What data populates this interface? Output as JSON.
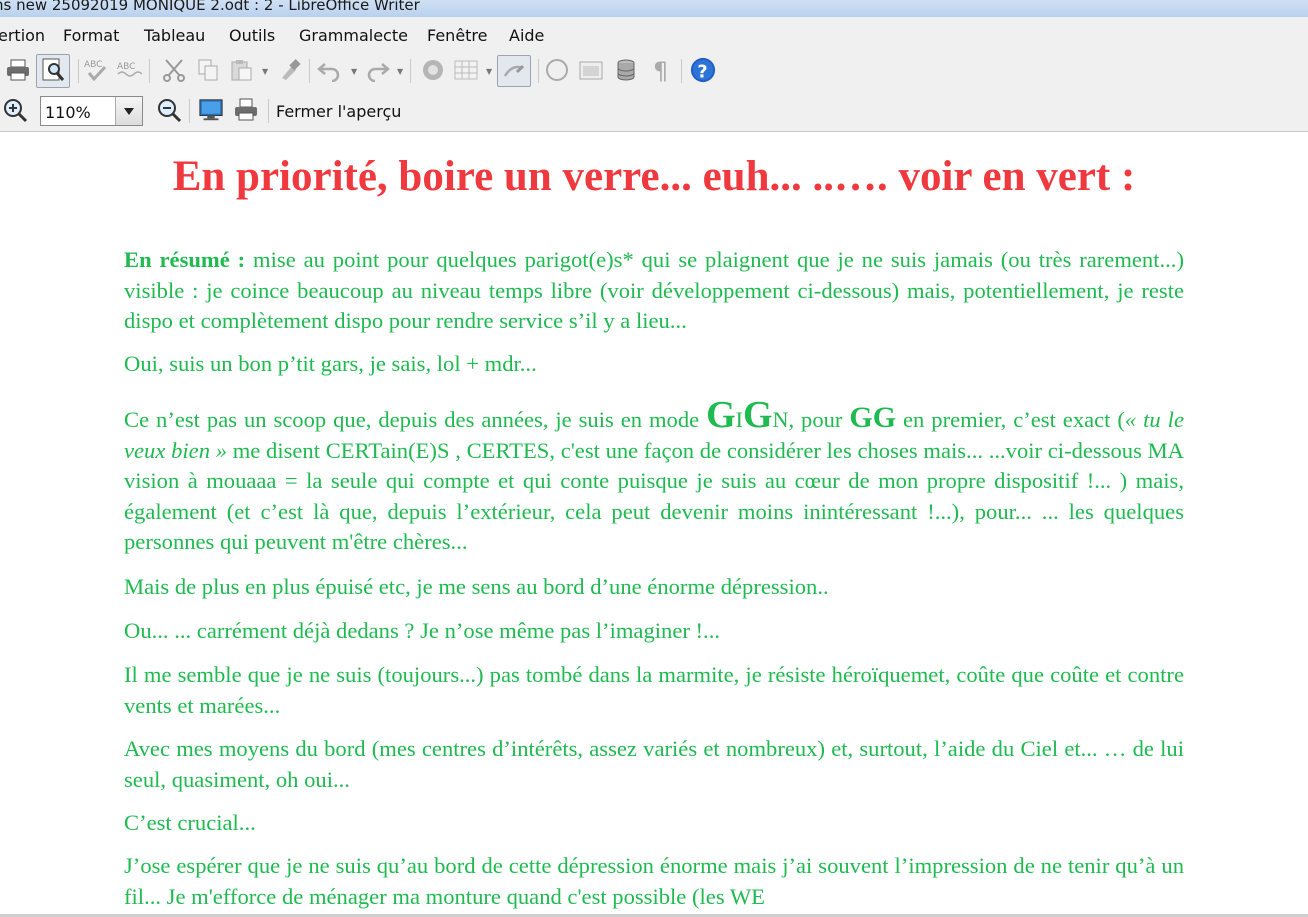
{
  "window": {
    "title": "ns new 25092019 MONIQUE   2.odt : 2 - LibreOffice Writer"
  },
  "menu": {
    "items": [
      "ertion",
      "Format",
      "Tableau",
      "Outils",
      "Grammalecte",
      "Fenêtre",
      "Aide"
    ]
  },
  "toolbar2": {
    "zoom_value": "110%",
    "close_preview_label": "Fermer l'aperçu"
  },
  "document": {
    "heading": "En priorité, boire un verre... euh... ..…. voir en vert :",
    "p1_lead": "En résumé :",
    "p1_text": " mise au point pour quelques parigot(e)s* qui se plaignent que je ne suis jamais (ou très rarement...) visible :  je coince beaucoup au niveau temps libre (voir développement ci-dessous) mais, potentiellement, je reste dispo et complètement dispo pour rendre service s’il y a lieu...",
    "p2": "Oui, suis un bon p’tit gars, je sais, lol + mdr...",
    "p3_a": "Ce n’est pas un scoop que, depuis des années, je suis en mode ",
    "p3_g1": "G",
    "p3_i": "I",
    "p3_g2": "G",
    "p3_n": "N",
    "p3_b": ", pour ",
    "p3_gg": "GG",
    "p3_c": " en premier, c’est exact (",
    "p3_quote": "« tu le veux bien »",
    "p3_d": " me disent CERTain(E)S , CERTES, c'est une façon de considérer les choses mais... ...voir ci-dessous MA vision à mouaaa =  la seule qui compte et qui conte puisque je suis au cœur de mon propre dispositif !... ) mais, également (et c’est là que, depuis l’extérieur, cela peut devenir moins inintéressant !...), pour... ... les quelques personnes qui peuvent m'être chères...",
    "p4": "Mais de plus en plus épuisé etc, je me sens au bord d’une énorme dépression..",
    "p5": "Ou... ... carrément déjà dedans ? Je n’ose même pas l’imaginer !...",
    "p6": "Il me semble que je ne suis (toujours...) pas tombé  dans la marmite, je résiste héroïquemet, coûte que coûte et contre vents et marées...",
    "p7": "Avec mes moyens du bord (mes centres d’intérêts, assez variés et nombreux) et, surtout, l’aide du Ciel et... … de lui seul, quasiment, oh oui...",
    "p8": "C’est crucial...",
    "p9": "J’ose espérer que je ne suis qu’au bord de cette dépression énorme mais j’ai souvent l’impression de ne tenir qu’à un fil... Je m'efforce de ménager ma monture quand c'est possible (les WE"
  },
  "colors": {
    "heading": "#f0393f",
    "body": "#1fba50",
    "help_icon": "#1f5fc1"
  }
}
